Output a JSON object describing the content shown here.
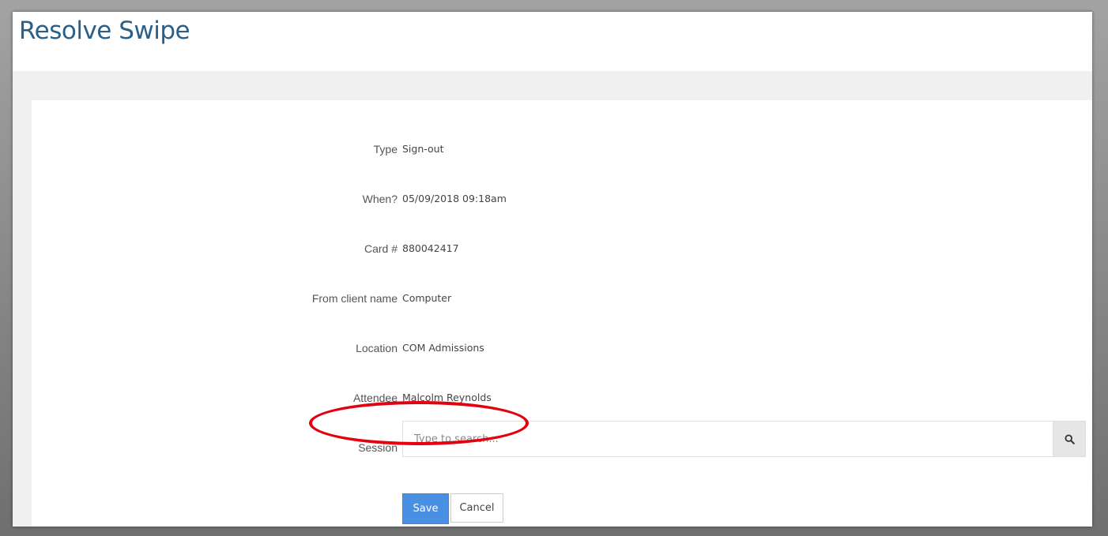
{
  "page": {
    "title": "Resolve Swipe"
  },
  "fields": [
    {
      "label": "Type",
      "value": "Sign-out"
    },
    {
      "label": "When?",
      "value": "05/09/2018 09:18am"
    },
    {
      "label": "Card #",
      "value": "880042417"
    },
    {
      "label": "From client name",
      "value": "Computer"
    },
    {
      "label": "Location",
      "value": "COM Admissions"
    },
    {
      "label": "Attendee",
      "value": "Malcolm Reynolds"
    }
  ],
  "session": {
    "label": "Session",
    "value": "",
    "placeholder": "Type to search...",
    "search_icon": "search-icon"
  },
  "actions": {
    "save_label": "Save",
    "cancel_label": "Cancel"
  },
  "annotation": {
    "shape": "ellipse",
    "color": "#e3000f"
  },
  "colors": {
    "title": "#2b5f87",
    "save_button": "#4a90e2"
  }
}
